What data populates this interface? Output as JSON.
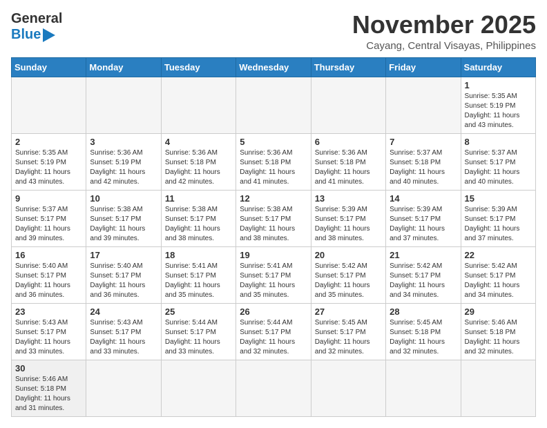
{
  "logo": {
    "general": "General",
    "blue": "Blue"
  },
  "title": {
    "month_year": "November 2025",
    "location": "Cayang, Central Visayas, Philippines"
  },
  "weekdays": [
    "Sunday",
    "Monday",
    "Tuesday",
    "Wednesday",
    "Thursday",
    "Friday",
    "Saturday"
  ],
  "weeks": [
    [
      {
        "day": "",
        "info": "",
        "empty": true
      },
      {
        "day": "",
        "info": "",
        "empty": true
      },
      {
        "day": "",
        "info": "",
        "empty": true
      },
      {
        "day": "",
        "info": "",
        "empty": true
      },
      {
        "day": "",
        "info": "",
        "empty": true
      },
      {
        "day": "",
        "info": "",
        "empty": true
      },
      {
        "day": "1",
        "info": "Sunrise: 5:35 AM\nSunset: 5:19 PM\nDaylight: 11 hours\nand 43 minutes."
      }
    ],
    [
      {
        "day": "2",
        "info": "Sunrise: 5:35 AM\nSunset: 5:19 PM\nDaylight: 11 hours\nand 43 minutes."
      },
      {
        "day": "3",
        "info": "Sunrise: 5:36 AM\nSunset: 5:19 PM\nDaylight: 11 hours\nand 42 minutes."
      },
      {
        "day": "4",
        "info": "Sunrise: 5:36 AM\nSunset: 5:18 PM\nDaylight: 11 hours\nand 42 minutes."
      },
      {
        "day": "5",
        "info": "Sunrise: 5:36 AM\nSunset: 5:18 PM\nDaylight: 11 hours\nand 41 minutes."
      },
      {
        "day": "6",
        "info": "Sunrise: 5:36 AM\nSunset: 5:18 PM\nDaylight: 11 hours\nand 41 minutes."
      },
      {
        "day": "7",
        "info": "Sunrise: 5:37 AM\nSunset: 5:18 PM\nDaylight: 11 hours\nand 40 minutes."
      },
      {
        "day": "8",
        "info": "Sunrise: 5:37 AM\nSunset: 5:17 PM\nDaylight: 11 hours\nand 40 minutes."
      }
    ],
    [
      {
        "day": "9",
        "info": "Sunrise: 5:37 AM\nSunset: 5:17 PM\nDaylight: 11 hours\nand 39 minutes."
      },
      {
        "day": "10",
        "info": "Sunrise: 5:38 AM\nSunset: 5:17 PM\nDaylight: 11 hours\nand 39 minutes."
      },
      {
        "day": "11",
        "info": "Sunrise: 5:38 AM\nSunset: 5:17 PM\nDaylight: 11 hours\nand 38 minutes."
      },
      {
        "day": "12",
        "info": "Sunrise: 5:38 AM\nSunset: 5:17 PM\nDaylight: 11 hours\nand 38 minutes."
      },
      {
        "day": "13",
        "info": "Sunrise: 5:39 AM\nSunset: 5:17 PM\nDaylight: 11 hours\nand 38 minutes."
      },
      {
        "day": "14",
        "info": "Sunrise: 5:39 AM\nSunset: 5:17 PM\nDaylight: 11 hours\nand 37 minutes."
      },
      {
        "day": "15",
        "info": "Sunrise: 5:39 AM\nSunset: 5:17 PM\nDaylight: 11 hours\nand 37 minutes."
      }
    ],
    [
      {
        "day": "16",
        "info": "Sunrise: 5:40 AM\nSunset: 5:17 PM\nDaylight: 11 hours\nand 36 minutes."
      },
      {
        "day": "17",
        "info": "Sunrise: 5:40 AM\nSunset: 5:17 PM\nDaylight: 11 hours\nand 36 minutes."
      },
      {
        "day": "18",
        "info": "Sunrise: 5:41 AM\nSunset: 5:17 PM\nDaylight: 11 hours\nand 35 minutes."
      },
      {
        "day": "19",
        "info": "Sunrise: 5:41 AM\nSunset: 5:17 PM\nDaylight: 11 hours\nand 35 minutes."
      },
      {
        "day": "20",
        "info": "Sunrise: 5:42 AM\nSunset: 5:17 PM\nDaylight: 11 hours\nand 35 minutes."
      },
      {
        "day": "21",
        "info": "Sunrise: 5:42 AM\nSunset: 5:17 PM\nDaylight: 11 hours\nand 34 minutes."
      },
      {
        "day": "22",
        "info": "Sunrise: 5:42 AM\nSunset: 5:17 PM\nDaylight: 11 hours\nand 34 minutes."
      }
    ],
    [
      {
        "day": "23",
        "info": "Sunrise: 5:43 AM\nSunset: 5:17 PM\nDaylight: 11 hours\nand 33 minutes."
      },
      {
        "day": "24",
        "info": "Sunrise: 5:43 AM\nSunset: 5:17 PM\nDaylight: 11 hours\nand 33 minutes."
      },
      {
        "day": "25",
        "info": "Sunrise: 5:44 AM\nSunset: 5:17 PM\nDaylight: 11 hours\nand 33 minutes."
      },
      {
        "day": "26",
        "info": "Sunrise: 5:44 AM\nSunset: 5:17 PM\nDaylight: 11 hours\nand 32 minutes."
      },
      {
        "day": "27",
        "info": "Sunrise: 5:45 AM\nSunset: 5:17 PM\nDaylight: 11 hours\nand 32 minutes."
      },
      {
        "day": "28",
        "info": "Sunrise: 5:45 AM\nSunset: 5:18 PM\nDaylight: 11 hours\nand 32 minutes."
      },
      {
        "day": "29",
        "info": "Sunrise: 5:46 AM\nSunset: 5:18 PM\nDaylight: 11 hours\nand 32 minutes."
      }
    ],
    [
      {
        "day": "30",
        "info": "Sunrise: 5:46 AM\nSunset: 5:18 PM\nDaylight: 11 hours\nand 31 minutes.",
        "last": true
      },
      {
        "day": "",
        "info": "",
        "empty": true
      },
      {
        "day": "",
        "info": "",
        "empty": true
      },
      {
        "day": "",
        "info": "",
        "empty": true
      },
      {
        "day": "",
        "info": "",
        "empty": true
      },
      {
        "day": "",
        "info": "",
        "empty": true
      },
      {
        "day": "",
        "info": "",
        "empty": true
      }
    ]
  ]
}
